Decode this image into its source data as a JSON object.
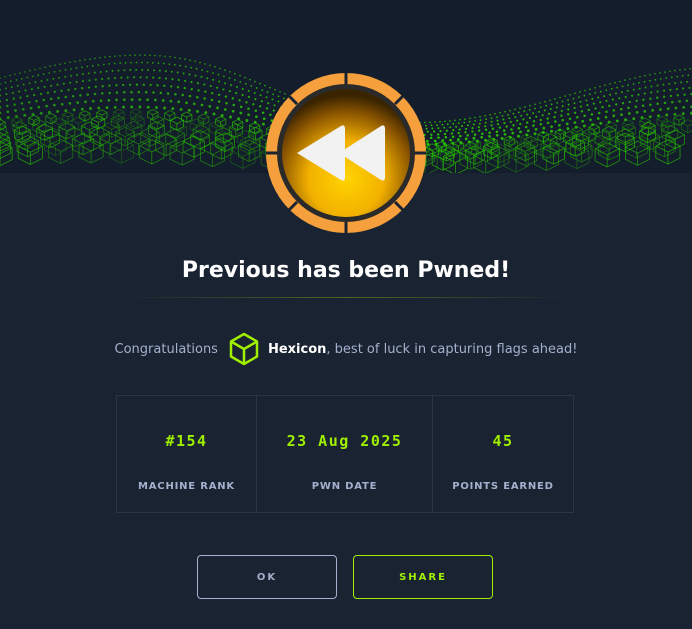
{
  "modal": {
    "title": "Previous has been Pwned!",
    "congrats_prefix": "Congratulations",
    "username": "Hexicon",
    "congrats_suffix": ", best of luck in capturing flags ahead!",
    "badge_icon": "rewind-icon",
    "user_icon": "cube-icon"
  },
  "stats": [
    {
      "value": "#154",
      "label": "MACHINE RANK"
    },
    {
      "value": "23 Aug 2025",
      "label": "PWN DATE"
    },
    {
      "value": "45",
      "label": "POINTS EARNED"
    }
  ],
  "buttons": {
    "ok": "OK",
    "share": "SHARE"
  },
  "colors": {
    "background": "#1a2332",
    "accent_green": "#9fef00",
    "muted_text": "#a4b1cd",
    "badge_orange": "#f5a03c",
    "badge_gold": "#f2c200"
  }
}
